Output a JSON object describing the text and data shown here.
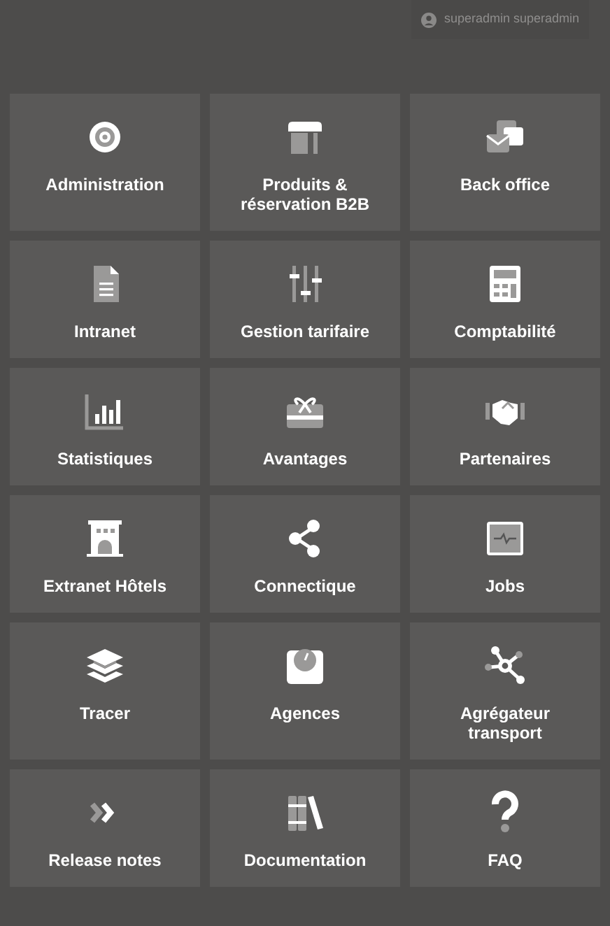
{
  "user_menu": {
    "label": "superadmin superadmin"
  },
  "tiles": [
    {
      "label": "Administration"
    },
    {
      "label": "Produits & réservation B2B"
    },
    {
      "label": "Back office"
    },
    {
      "label": "Intranet"
    },
    {
      "label": "Gestion tarifaire"
    },
    {
      "label": "Comptabilité"
    },
    {
      "label": "Statistiques"
    },
    {
      "label": "Avantages"
    },
    {
      "label": "Partenaires"
    },
    {
      "label": "Extranet Hôtels"
    },
    {
      "label": "Connectique"
    },
    {
      "label": "Jobs"
    },
    {
      "label": "Tracer"
    },
    {
      "label": "Agences"
    },
    {
      "label": "Agrégateur transport"
    },
    {
      "label": "Release notes"
    },
    {
      "label": "Documentation"
    },
    {
      "label": "FAQ"
    }
  ]
}
